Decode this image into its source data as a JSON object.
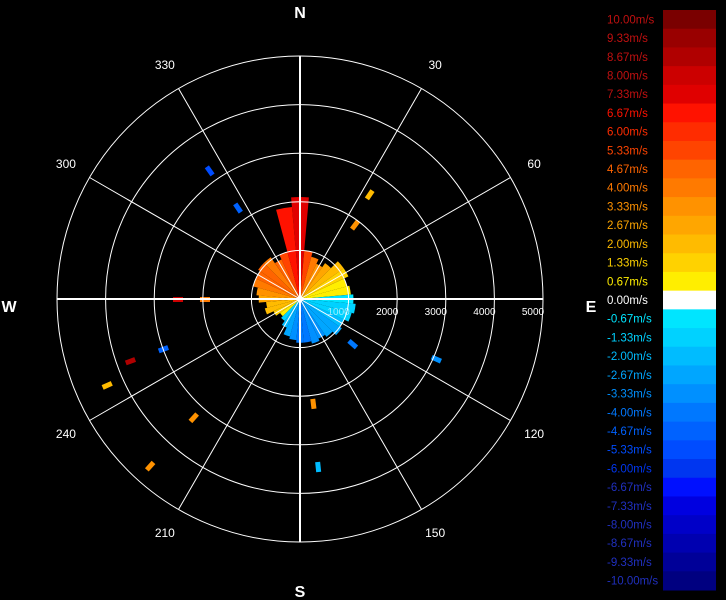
{
  "chart_data": {
    "type": "polar-radar-ppi",
    "cardinal_labels": {
      "N": "N",
      "E": "E",
      "S": "S",
      "W": "W"
    },
    "azimuth_labels": [
      {
        "az": 30,
        "label": "30"
      },
      {
        "az": 60,
        "label": "60"
      },
      {
        "az": 120,
        "label": "120"
      },
      {
        "az": 150,
        "label": "150"
      },
      {
        "az": 210,
        "label": "210"
      },
      {
        "az": 240,
        "label": "240"
      },
      {
        "az": 300,
        "label": "300"
      },
      {
        "az": 330,
        "label": "330"
      }
    ],
    "range_rings": [
      1000,
      2000,
      3000,
      4000,
      5000
    ],
    "range_labels": [
      "1000",
      "2000",
      "3000",
      "4000",
      "5000"
    ],
    "max_range": 5000,
    "spoke_interval_deg": 30,
    "grid": true,
    "colorbar": {
      "position": "right",
      "levels": [
        {
          "label": "10.00m/s",
          "value": 10.0,
          "color": "#7a0000"
        },
        {
          "label": "9.33m/s",
          "value": 9.33,
          "color": "#990000"
        },
        {
          "label": "8.67m/s",
          "value": 8.67,
          "color": "#b00000"
        },
        {
          "label": "8.00m/s",
          "value": 8.0,
          "color": "#cc0000"
        },
        {
          "label": "7.33m/s",
          "value": 7.33,
          "color": "#e00000"
        },
        {
          "label": "6.67m/s",
          "value": 6.67,
          "color": "#ff1200"
        },
        {
          "label": "6.00m/s",
          "value": 6.0,
          "color": "#ff2c00"
        },
        {
          "label": "5.33m/s",
          "value": 5.33,
          "color": "#ff4400"
        },
        {
          "label": "4.67m/s",
          "value": 4.67,
          "color": "#ff6400"
        },
        {
          "label": "4.00m/s",
          "value": 4.0,
          "color": "#ff7a00"
        },
        {
          "label": "3.33m/s",
          "value": 3.33,
          "color": "#ff9200"
        },
        {
          "label": "2.67m/s",
          "value": 2.67,
          "color": "#ffa600"
        },
        {
          "label": "2.00m/s",
          "value": 2.0,
          "color": "#ffbb00"
        },
        {
          "label": "1.33m/s",
          "value": 1.33,
          "color": "#ffd200"
        },
        {
          "label": "0.67m/s",
          "value": 0.67,
          "color": "#ffee00"
        },
        {
          "label": "0.00m/s",
          "value": 0.0,
          "color": "#ffffff"
        },
        {
          "label": "-0.67m/s",
          "value": -0.67,
          "color": "#00e5ff"
        },
        {
          "label": "-1.33m/s",
          "value": -1.33,
          "color": "#00d2ff"
        },
        {
          "label": "-2.00m/s",
          "value": -2.0,
          "color": "#00bcff"
        },
        {
          "label": "-2.67m/s",
          "value": -2.67,
          "color": "#00a6ff"
        },
        {
          "label": "-3.33m/s",
          "value": -3.33,
          "color": "#0090ff"
        },
        {
          "label": "-4.00m/s",
          "value": -4.0,
          "color": "#0078ff"
        },
        {
          "label": "-4.67m/s",
          "value": -4.67,
          "color": "#0062ff"
        },
        {
          "label": "-5.33m/s",
          "value": -5.33,
          "color": "#004cff"
        },
        {
          "label": "-6.00m/s",
          "value": -6.0,
          "color": "#0036f0"
        },
        {
          "label": "-6.67m/s",
          "value": -6.67,
          "color": "#0010ff"
        },
        {
          "label": "-7.33m/s",
          "value": -7.33,
          "color": "#0000e0"
        },
        {
          "label": "-8.00m/s",
          "value": -8.0,
          "color": "#0000c8"
        },
        {
          "label": "-8.67m/s",
          "value": -8.67,
          "color": "#0000b0"
        },
        {
          "label": "-9.33m/s",
          "value": -9.33,
          "color": "#000098"
        },
        {
          "label": "-10.00m/s",
          "value": -10.0,
          "color": "#000080"
        }
      ]
    },
    "core_echo": [
      {
        "az": 0,
        "range": 2100,
        "velocity": 7.33
      },
      {
        "az": 10,
        "range": 1000,
        "velocity": 5.33
      },
      {
        "az": 20,
        "range": 900,
        "velocity": 4.0
      },
      {
        "az": 30,
        "range": 800,
        "velocity": 3.33
      },
      {
        "az": 40,
        "range": 900,
        "velocity": 2.67
      },
      {
        "az": 50,
        "range": 1100,
        "velocity": 2.0
      },
      {
        "az": 60,
        "range": 1100,
        "velocity": 1.33
      },
      {
        "az": 70,
        "range": 1000,
        "velocity": 0.67
      },
      {
        "az": 80,
        "range": 1050,
        "velocity": 0.67
      },
      {
        "az": 90,
        "range": 1100,
        "velocity": -0.67
      },
      {
        "az": 100,
        "range": 1150,
        "velocity": -1.33
      },
      {
        "az": 110,
        "range": 1100,
        "velocity": -1.33
      },
      {
        "az": 120,
        "range": 1000,
        "velocity": -2.0
      },
      {
        "az": 130,
        "range": 1050,
        "velocity": -2.67
      },
      {
        "az": 140,
        "range": 950,
        "velocity": -2.67
      },
      {
        "az": 150,
        "range": 900,
        "velocity": -3.33
      },
      {
        "az": 160,
        "range": 950,
        "velocity": -3.33
      },
      {
        "az": 170,
        "range": 900,
        "velocity": -4.0
      },
      {
        "az": 180,
        "range": 900,
        "velocity": -4.0
      },
      {
        "az": 190,
        "range": 850,
        "velocity": -3.33
      },
      {
        "az": 200,
        "range": 800,
        "velocity": -2.67
      },
      {
        "az": 210,
        "range": 650,
        "velocity": -2.0
      },
      {
        "az": 220,
        "range": 550,
        "velocity": -1.33
      },
      {
        "az": 230,
        "range": 500,
        "velocity": 0.67
      },
      {
        "az": 240,
        "range": 600,
        "velocity": 1.33
      },
      {
        "az": 250,
        "range": 750,
        "velocity": 2.0
      },
      {
        "az": 260,
        "range": 700,
        "velocity": 2.0
      },
      {
        "az": 270,
        "range": 850,
        "velocity": 2.67
      },
      {
        "az": 280,
        "range": 900,
        "velocity": 3.33
      },
      {
        "az": 290,
        "range": 1000,
        "velocity": 4.0
      },
      {
        "az": 300,
        "range": 1000,
        "velocity": 4.67
      },
      {
        "az": 310,
        "range": 1050,
        "velocity": 4.67
      },
      {
        "az": 320,
        "range": 1050,
        "velocity": 4.0
      },
      {
        "az": 330,
        "range": 900,
        "velocity": 4.67
      },
      {
        "az": 340,
        "range": 1000,
        "velocity": 5.33
      },
      {
        "az": 350,
        "range": 1900,
        "velocity": 6.67
      }
    ],
    "scattered_gates": [
      {
        "az": 325,
        "range": 3225,
        "velocity": -5.33
      },
      {
        "az": 326,
        "range": 2265,
        "velocity": -4.67
      },
      {
        "az": 34,
        "range": 2580,
        "velocity": 2.0
      },
      {
        "az": 37,
        "range": 1895,
        "velocity": 3.33
      },
      {
        "az": 270,
        "range": 2510,
        "velocity": 8.0
      },
      {
        "az": 270,
        "range": 1955,
        "velocity": 4.0
      },
      {
        "az": 250,
        "range": 3716,
        "velocity": 8.67
      },
      {
        "az": 246,
        "range": 4347,
        "velocity": 2.0
      },
      {
        "az": 250,
        "range": 2994,
        "velocity": -4.67
      },
      {
        "az": 222,
        "range": 3278,
        "velocity": 3.33
      },
      {
        "az": 222,
        "range": 4619,
        "velocity": 3.33
      },
      {
        "az": 174,
        "range": 3477,
        "velocity": -2.0
      },
      {
        "az": 114,
        "range": 3067,
        "velocity": -3.33
      },
      {
        "az": 173,
        "range": 2175,
        "velocity": 3.33
      },
      {
        "az": 131,
        "range": 1428,
        "velocity": -4.0
      }
    ]
  }
}
